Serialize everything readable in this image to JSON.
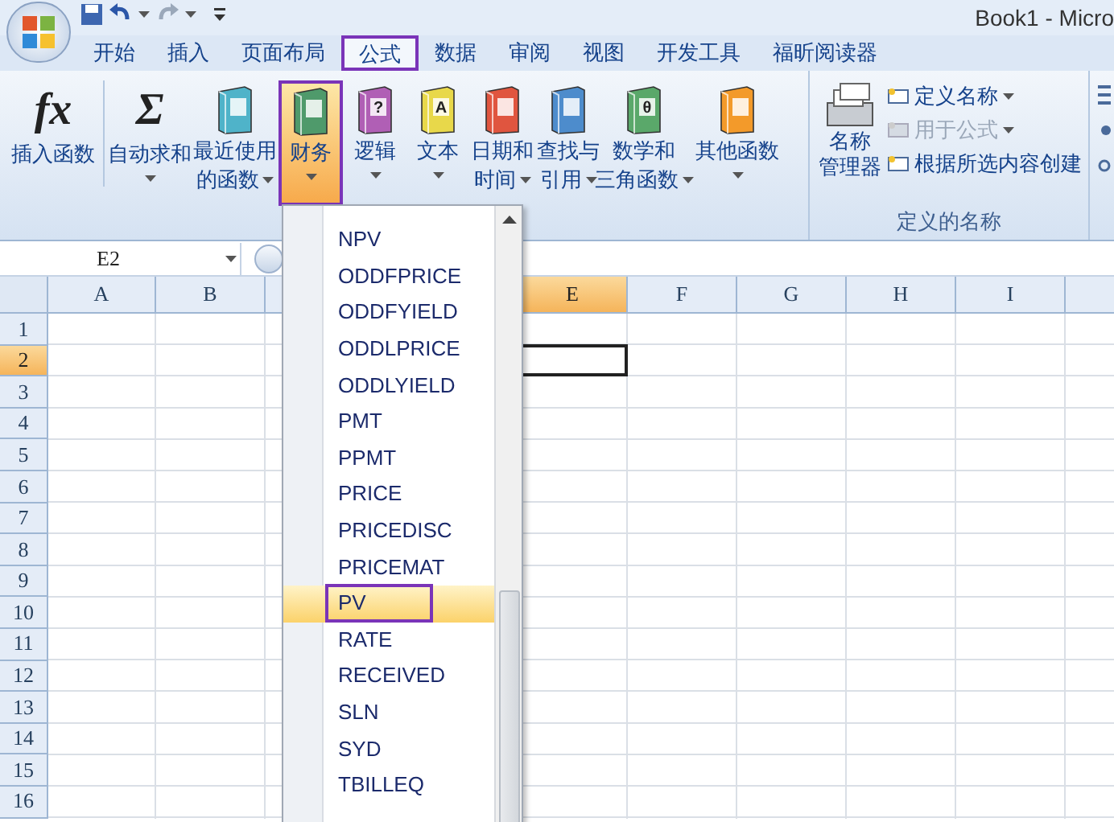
{
  "title_bar": {
    "title": "Book1 - Micro"
  },
  "tabs": [
    {
      "label": "开始",
      "selected": false,
      "outlined": false
    },
    {
      "label": "插入",
      "selected": false,
      "outlined": false
    },
    {
      "label": "页面布局",
      "selected": false,
      "outlined": false
    },
    {
      "label": "公式",
      "selected": true,
      "outlined": true
    },
    {
      "label": "数据",
      "selected": false,
      "outlined": false
    },
    {
      "label": "审阅",
      "selected": false,
      "outlined": false
    },
    {
      "label": "视图",
      "selected": false,
      "outlined": false
    },
    {
      "label": "开发工具",
      "selected": false,
      "outlined": false
    },
    {
      "label": "福昕阅读器",
      "selected": false,
      "outlined": false
    }
  ],
  "function_library": {
    "buttons": [
      {
        "kind": "symbol",
        "symbol": "fx",
        "lines": [
          "插入函数"
        ],
        "has_menu": false,
        "selected": false,
        "outlined": false
      },
      {
        "kind": "symbol",
        "symbol": "Σ",
        "lines": [
          "自动求和"
        ],
        "has_menu": true,
        "selected": false,
        "outlined": false
      },
      {
        "kind": "book",
        "color": "#4fb3c9",
        "lines": [
          "最近使用",
          "的函数"
        ],
        "has_menu": true,
        "selected": false,
        "outlined": false
      },
      {
        "kind": "book",
        "color": "#4f9a6b",
        "lines": [
          "财务"
        ],
        "has_menu": true,
        "selected": true,
        "outlined": true
      },
      {
        "kind": "book",
        "color": "#b05fb5",
        "symbol": "?",
        "lines": [
          "逻辑"
        ],
        "has_menu": true,
        "selected": false,
        "outlined": false
      },
      {
        "kind": "book",
        "color": "#e8d84a",
        "symbol": "A",
        "lines": [
          "文本"
        ],
        "has_menu": true,
        "selected": false,
        "outlined": false
      },
      {
        "kind": "book",
        "color": "#e0553f",
        "lines": [
          "日期和",
          "时间"
        ],
        "has_menu": true,
        "selected": false,
        "outlined": false
      },
      {
        "kind": "book",
        "color": "#4d8ccc",
        "lines": [
          "查找与",
          "引用"
        ],
        "has_menu": true,
        "selected": false,
        "outlined": false
      },
      {
        "kind": "book",
        "color": "#5aa86a",
        "symbol": "θ",
        "lines": [
          "数学和",
          "三角函数"
        ],
        "has_menu": true,
        "selected": false,
        "outlined": false
      },
      {
        "kind": "book",
        "color": "#f39a2a",
        "lines": [
          "其他函数"
        ],
        "has_menu": true,
        "selected": false,
        "outlined": false
      }
    ]
  },
  "defined_names": {
    "title": "定义的名称",
    "manager_lines": [
      "名称",
      "管理器"
    ],
    "items": [
      {
        "label": "定义名称",
        "has_menu": true,
        "disabled": false
      },
      {
        "label": "用于公式",
        "has_menu": true,
        "disabled": true
      },
      {
        "label": "根据所选内容创建",
        "has_menu": false,
        "disabled": false
      }
    ]
  },
  "formula_bar": {
    "name_box": "E2"
  },
  "grid": {
    "columns": [
      {
        "label": "A",
        "selected": false
      },
      {
        "label": "B",
        "selected": false
      },
      {
        "label": "E",
        "selected": true
      },
      {
        "label": "F",
        "selected": false
      },
      {
        "label": "G",
        "selected": false
      },
      {
        "label": "H",
        "selected": false
      },
      {
        "label": "I",
        "selected": false
      }
    ],
    "rows": [
      {
        "label": "1",
        "selected": false
      },
      {
        "label": "2",
        "selected": true
      },
      {
        "label": "3",
        "selected": false
      },
      {
        "label": "4",
        "selected": false
      },
      {
        "label": "5",
        "selected": false
      },
      {
        "label": "6",
        "selected": false
      },
      {
        "label": "7",
        "selected": false
      },
      {
        "label": "8",
        "selected": false
      },
      {
        "label": "9",
        "selected": false
      },
      {
        "label": "10",
        "selected": false
      },
      {
        "label": "11",
        "selected": false
      },
      {
        "label": "12",
        "selected": false
      },
      {
        "label": "13",
        "selected": false
      },
      {
        "label": "14",
        "selected": false
      },
      {
        "label": "15",
        "selected": false
      },
      {
        "label": "16",
        "selected": false
      }
    ]
  },
  "function_menu": {
    "items": [
      {
        "label": "NPV",
        "selected": false,
        "outlined": false
      },
      {
        "label": "ODDFPRICE",
        "selected": false,
        "outlined": false
      },
      {
        "label": "ODDFYIELD",
        "selected": false,
        "outlined": false
      },
      {
        "label": "ODDLPRICE",
        "selected": false,
        "outlined": false
      },
      {
        "label": "ODDLYIELD",
        "selected": false,
        "outlined": false
      },
      {
        "label": "PMT",
        "selected": false,
        "outlined": false
      },
      {
        "label": "PPMT",
        "selected": false,
        "outlined": false
      },
      {
        "label": "PRICE",
        "selected": false,
        "outlined": false
      },
      {
        "label": "PRICEDISC",
        "selected": false,
        "outlined": false
      },
      {
        "label": "PRICEMAT",
        "selected": false,
        "outlined": false
      },
      {
        "label": "PV",
        "selected": true,
        "outlined": true
      },
      {
        "label": "RATE",
        "selected": false,
        "outlined": false
      },
      {
        "label": "RECEIVED",
        "selected": false,
        "outlined": false
      },
      {
        "label": "SLN",
        "selected": false,
        "outlined": false
      },
      {
        "label": "SYD",
        "selected": false,
        "outlined": false
      },
      {
        "label": "TBILLEQ",
        "selected": false,
        "outlined": false
      }
    ]
  }
}
